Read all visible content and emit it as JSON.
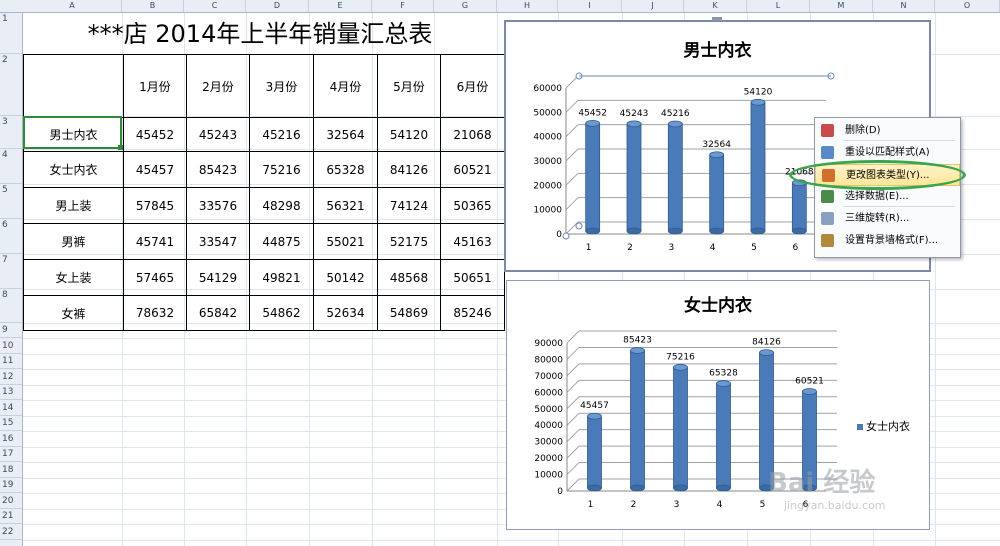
{
  "columns": [
    "A",
    "B",
    "C",
    "D",
    "E",
    "F",
    "G",
    "H",
    "I",
    "J",
    "K",
    "L",
    "M",
    "N",
    "O"
  ],
  "rows": [
    "1",
    "2",
    "3",
    "4",
    "5",
    "6",
    "7",
    "8",
    "9",
    "10",
    "11",
    "12",
    "13",
    "14",
    "15",
    "16",
    "17",
    "18",
    "19",
    "20",
    "21",
    "22"
  ],
  "sheet_title": "***店 2014年上半年销量汇总表",
  "table": {
    "header": [
      "",
      "1月份",
      "2月份",
      "3月份",
      "4月份",
      "5月份",
      "6月份"
    ],
    "body": [
      [
        "男士内衣",
        "45452",
        "45243",
        "45216",
        "32564",
        "54120",
        "21068"
      ],
      [
        "女士内衣",
        "45457",
        "85423",
        "75216",
        "65328",
        "84126",
        "60521"
      ],
      [
        "男上装",
        "57845",
        "33576",
        "48298",
        "56321",
        "74124",
        "50365"
      ],
      [
        "男裤",
        "45741",
        "33547",
        "44875",
        "55021",
        "52175",
        "45163"
      ],
      [
        "女上装",
        "57465",
        "54129",
        "49821",
        "50142",
        "48568",
        "50651"
      ],
      [
        "女裤",
        "78632",
        "65842",
        "54862",
        "52634",
        "54869",
        "85246"
      ]
    ]
  },
  "chart_data": [
    {
      "type": "bar",
      "title": "男士内衣",
      "categories": [
        "1",
        "2",
        "3",
        "4",
        "5",
        "6"
      ],
      "values": [
        45452,
        45243,
        45216,
        32564,
        54120,
        21068
      ],
      "data_labels": [
        "45452",
        "45243",
        "45216",
        "32564",
        "54120",
        "21068"
      ],
      "yticks": [
        "0",
        "10000",
        "20000",
        "30000",
        "40000",
        "50000",
        "60000"
      ],
      "ylim": [
        0,
        60000
      ],
      "grid": true,
      "color": "#4a7ab8"
    },
    {
      "type": "bar",
      "title": "女士内衣",
      "categories": [
        "1",
        "2",
        "3",
        "4",
        "5",
        "6"
      ],
      "values": [
        45457,
        85423,
        75216,
        65328,
        84126,
        60521
      ],
      "data_labels": [
        "45457",
        "85423",
        "75216",
        "65328",
        "84126",
        "60521"
      ],
      "yticks": [
        "0",
        "10000",
        "20000",
        "30000",
        "40000",
        "50000",
        "60000",
        "70000",
        "80000",
        "90000"
      ],
      "ylim": [
        0,
        90000
      ],
      "grid": true,
      "legend": "女士内衣",
      "legend_position": "right",
      "color": "#4a7ab8"
    }
  ],
  "context_menu": {
    "items": [
      {
        "label": "删除(D)",
        "icon": "delete-icon"
      },
      {
        "label": "重设以匹配样式(A)",
        "icon": "reset-style-icon"
      },
      {
        "label": "更改图表类型(Y)...",
        "icon": "change-chart-type-icon",
        "highlighted": true
      },
      {
        "label": "选择数据(E)...",
        "icon": "select-data-icon"
      },
      {
        "label": "三维旋转(R)...",
        "icon": "rotate-3d-icon"
      },
      {
        "label": "设置背景墙格式(F)...",
        "icon": "format-wall-icon"
      }
    ]
  },
  "watermark": {
    "text": "Bai 经验",
    "sub": "jingyan.baidu.com"
  },
  "colors": {
    "accent_bar": "#4a7ab8",
    "highlight_ring": "#3aa64a",
    "selection": "#2e8b3a"
  }
}
